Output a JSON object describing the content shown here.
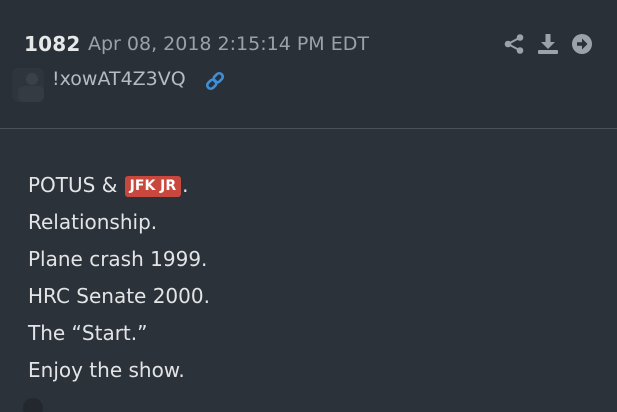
{
  "post": {
    "number": "1082",
    "timestamp": "Apr 08, 2018 2:15:14 PM EDT",
    "tripcode": "!xowAT4Z3VQ",
    "actions": {
      "share_icon": "share-icon",
      "download_icon": "download-icon",
      "goto_icon": "arrow-right-circle-icon"
    },
    "link_icon": "link-icon",
    "body": {
      "line1_prefix": "POTUS & ",
      "line1_tag": "JFK JR",
      "line1_suffix": ".",
      "lines": [
        "Relationship.",
        "Plane crash 1999.",
        "HRC Senate 2000.",
        "The “Start.”",
        "Enjoy the show."
      ]
    }
  },
  "colors": {
    "background": "#2c323a",
    "header_background": "#2a3038",
    "tag_background": "#c9483e",
    "link_blue": "#3f8fd8",
    "text_primary": "#e2e4e6",
    "text_muted": "#9aa1a8"
  }
}
